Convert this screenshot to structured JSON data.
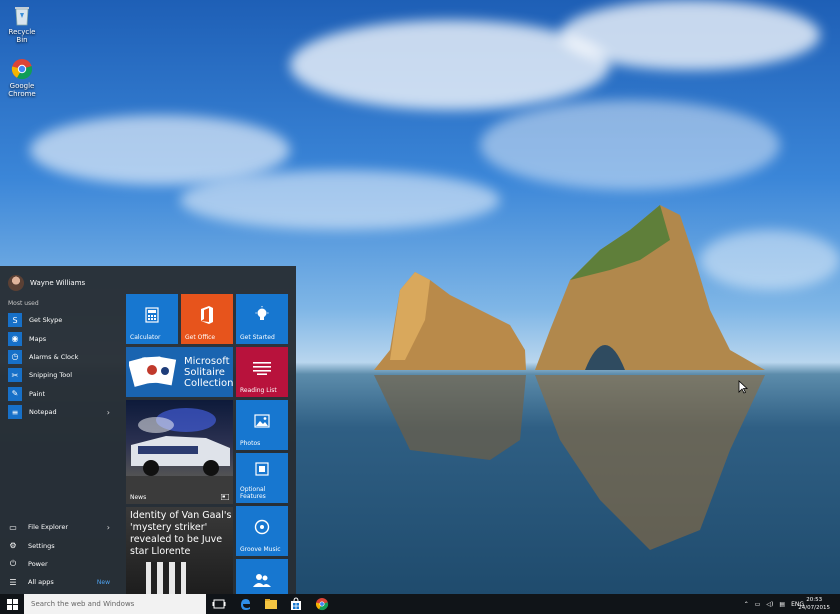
{
  "desktop": {
    "icons": [
      {
        "label": "Recycle Bin",
        "icon": "recycle-bin-icon"
      },
      {
        "label": "Google Chrome",
        "icon": "chrome-icon"
      }
    ]
  },
  "start_menu": {
    "user_name": "Wayne Williams",
    "most_used_label": "Most used",
    "apps": [
      {
        "label": "Get Skype",
        "icon": "skype-icon",
        "glyph": "S"
      },
      {
        "label": "Maps",
        "icon": "maps-icon",
        "glyph": "◉"
      },
      {
        "label": "Alarms & Clock",
        "icon": "alarm-clock-icon",
        "glyph": "◷"
      },
      {
        "label": "Snipping Tool",
        "icon": "scissors-icon",
        "glyph": "✂"
      },
      {
        "label": "Paint",
        "icon": "paint-icon",
        "glyph": "✎"
      },
      {
        "label": "Notepad",
        "icon": "notepad-icon",
        "glyph": "≡",
        "chevron": "›"
      }
    ],
    "bottom": [
      {
        "label": "File Explorer",
        "icon": "folder-icon",
        "glyph": "▭",
        "chevron": "›"
      },
      {
        "label": "Settings",
        "icon": "gear-icon",
        "glyph": "⚙"
      },
      {
        "label": "Power",
        "icon": "power-icon",
        "glyph": "⏻"
      },
      {
        "label": "All apps",
        "icon": "list-icon",
        "glyph": "☰",
        "badge": "New"
      }
    ],
    "tiles": {
      "calculator": "Calculator",
      "get_office": "Get Office",
      "get_started": "Get Started",
      "solitaire": "Microsoft Solitaire Collection",
      "reading_list": "Reading List",
      "news": "News",
      "photos": "Photos",
      "optional_features": "Optional Features",
      "groove_music": "Groove Music",
      "headline": "Identity of Van Gaal's 'mystery striker' revealed to be Juve star Llorente"
    }
  },
  "taskbar": {
    "search_placeholder": "Search the web and Windows",
    "language": "ENG",
    "time": "20:53",
    "date": "24/07/2015"
  },
  "colors": {
    "accent_blue": "#1777d0",
    "office_orange": "#e7541c",
    "reading_list_crimson": "#b8123c",
    "start_bg": "#282e34",
    "taskbar_bg": "#101418"
  }
}
